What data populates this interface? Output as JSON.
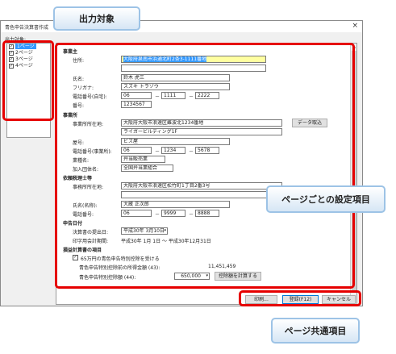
{
  "window": {
    "title": "青色申告決算書作成",
    "close": "×",
    "output_label": "出力対象:"
  },
  "pages": [
    {
      "label": "1ページ",
      "checked": true,
      "selected": true
    },
    {
      "label": "2ページ",
      "checked": true,
      "selected": false
    },
    {
      "label": "3ページ",
      "checked": true,
      "selected": false
    },
    {
      "label": "4ページ",
      "checked": true,
      "selected": false
    }
  ],
  "business_owner": {
    "heading": "事業主",
    "address_label": "住所:",
    "address_value": "大阪府泉南市浜通北町2条3-1111番地",
    "name_label": "氏名:",
    "name_value": "鈴木 虎三",
    "furigana_label": "フリガナ:",
    "furigana_value": "スズキ トラゾウ",
    "phone_label": "電話番号(自宅):",
    "phone": [
      "06",
      "1111",
      "2222"
    ],
    "number_label": "番号:",
    "number_value": "1234567"
  },
  "office": {
    "heading": "事業所",
    "address_label": "事業所所在地:",
    "address_value": "大阪府大阪市浪速区難波北1234番地",
    "address2_value": "ライガービルディング1F",
    "fetch_button": "データ取込",
    "trade_name_label": "屋号:",
    "trade_name_value": "ビズ屋",
    "phone_label": "電話番号(事業所):",
    "phone": [
      "06",
      "1234",
      "5678"
    ],
    "industry_label": "業種名:",
    "industry_value": "弁当販売業",
    "association_label": "加入団体名:",
    "association_value": "全国弁当業組合"
  },
  "tax_accountant": {
    "heading": "依頼税理士等",
    "address_label": "事務所所在地:",
    "address_value": "大阪府大阪市浪速区松竹町1丁目2番3号",
    "name_label": "氏名(名称):",
    "name_value": "大蔵 正次郎",
    "phone_label": "電話番号:",
    "phone": [
      "06",
      "9999",
      "8888"
    ]
  },
  "dates": {
    "heading": "申告日付",
    "filing_date_label": "決算書の提出日:",
    "filing_date_value": "平成30年 3月10日",
    "period_label": "印字用会計期間:",
    "period_value": "平成30年 1月 1日 ～ 平成30年12月31日"
  },
  "deduction": {
    "heading": "損益計算書の項目",
    "checkbox_label": "65万円の青色申告特別控除を受ける",
    "before_label": "青色申告特別控除前の所得金額 (43):",
    "before_value": "11,451,459",
    "deduction_label": "青色申告特別控除額 (44):",
    "deduction_value": "650,000",
    "recalc_button": "控除額を計算する"
  },
  "footer": {
    "print_button": "印刷...",
    "register_button": "登録(F12)",
    "cancel_button": "キャンセル"
  },
  "callouts": {
    "output_target": "出力対象",
    "page_settings": "ページごとの設定項目",
    "common_items": "ページ共通項目"
  },
  "colors": {
    "accent": "#e60000",
    "callout_border": "#9dc3e6",
    "selection": "#3399ff",
    "highlight_field": "#ffffa0"
  }
}
